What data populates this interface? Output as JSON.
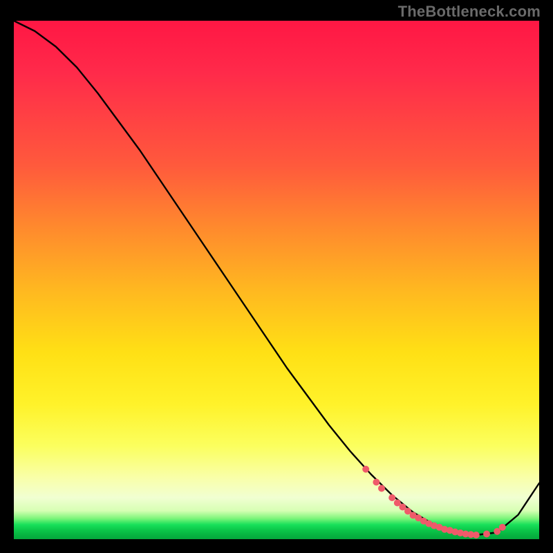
{
  "watermark": "TheBottleneck.com",
  "chart_data": {
    "type": "line",
    "title": "",
    "xlabel": "",
    "ylabel": "",
    "xlim": [
      0,
      100
    ],
    "ylim": [
      0,
      100
    ],
    "grid": false,
    "legend": false,
    "series": [
      {
        "name": "curve",
        "color": "#000000",
        "x": [
          0,
          4,
          8,
          12,
          16,
          20,
          24,
          28,
          32,
          36,
          40,
          44,
          48,
          52,
          56,
          60,
          64,
          68,
          72,
          76,
          80,
          84,
          88,
          92,
          96,
          100
        ],
        "y": [
          100,
          98,
          95,
          91,
          86,
          80.5,
          75,
          69,
          63,
          57,
          51,
          45,
          39,
          33,
          27.5,
          22,
          17,
          12.5,
          8.5,
          5.2,
          2.8,
          1.4,
          0.8,
          1.3,
          4.7,
          10.8
        ]
      }
    ],
    "markers": {
      "name": "dots",
      "color": "#ef5a6a",
      "x": [
        67,
        69,
        70,
        72,
        73,
        74,
        75,
        76,
        77,
        78,
        79,
        80,
        81,
        82,
        83,
        84,
        85,
        86,
        87,
        88,
        90,
        92,
        93
      ],
      "y": [
        13.5,
        11,
        9.8,
        8,
        7,
        6.2,
        5.4,
        4.6,
        4.1,
        3.5,
        3.0,
        2.6,
        2.3,
        1.9,
        1.7,
        1.4,
        1.2,
        1.0,
        0.9,
        0.8,
        1.0,
        1.5,
        2.3
      ]
    },
    "background_gradient": {
      "orientation": "vertical",
      "stops": [
        {
          "pos": 0.0,
          "color": "#ff1744"
        },
        {
          "pos": 0.28,
          "color": "#ff5a3c"
        },
        {
          "pos": 0.52,
          "color": "#ffb820"
        },
        {
          "pos": 0.74,
          "color": "#fff22a"
        },
        {
          "pos": 0.92,
          "color": "#f1ffd2"
        },
        {
          "pos": 0.97,
          "color": "#18e05a"
        },
        {
          "pos": 1.0,
          "color": "#05a63c"
        }
      ]
    }
  }
}
